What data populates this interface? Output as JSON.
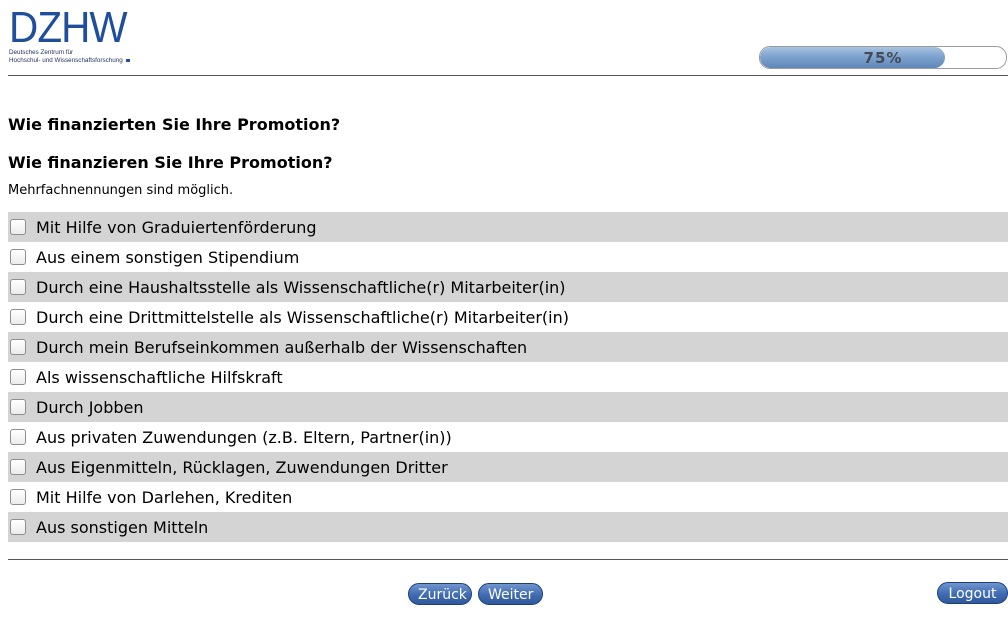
{
  "header": {
    "logo_text": "DZHW",
    "logo_subtitle_line1": "Deutsches Zentrum für",
    "logo_subtitle_line2": "Hochschul- und Wissenschaftsforschung",
    "progress_label": "75%",
    "progress_value": 0.75
  },
  "question": {
    "title_past": "Wie finanzierten Sie Ihre Promotion?",
    "title_present": "Wie finanzieren Sie Ihre Promotion?",
    "hint": "Mehrfachnennungen sind möglich.",
    "options": [
      {
        "label": "Mit Hilfe von Graduiertenförderung",
        "checked": false
      },
      {
        "label": "Aus einem sonstigen Stipendium",
        "checked": false
      },
      {
        "label": "Durch eine Haushaltsstelle als Wissenschaftliche(r) Mitarbeiter(in)",
        "checked": false
      },
      {
        "label": "Durch eine Drittmittelstelle als Wissenschaftliche(r) Mitarbeiter(in)",
        "checked": false
      },
      {
        "label": "Durch mein Berufseinkommen außerhalb der Wissenschaften",
        "checked": false
      },
      {
        "label": "Als wissenschaftliche Hilfskraft",
        "checked": false
      },
      {
        "label": "Durch Jobben",
        "checked": false
      },
      {
        "label": "Aus privaten Zuwendungen (z.B. Eltern, Partner(in))",
        "checked": false
      },
      {
        "label": "Aus Eigenmitteln, Rücklagen, Zuwendungen Dritter",
        "checked": false
      },
      {
        "label": "Mit Hilfe von Darlehen, Krediten",
        "checked": false
      },
      {
        "label": "Aus sonstigen Mitteln",
        "checked": false
      }
    ]
  },
  "nav": {
    "back_label": "Zurück",
    "next_label": "Weiter",
    "logout_label": "Logout"
  },
  "colors": {
    "logo_blue": "#1f4f9c",
    "row_shade": "#d4d4d4",
    "button_blue": "#3f6bb0"
  }
}
